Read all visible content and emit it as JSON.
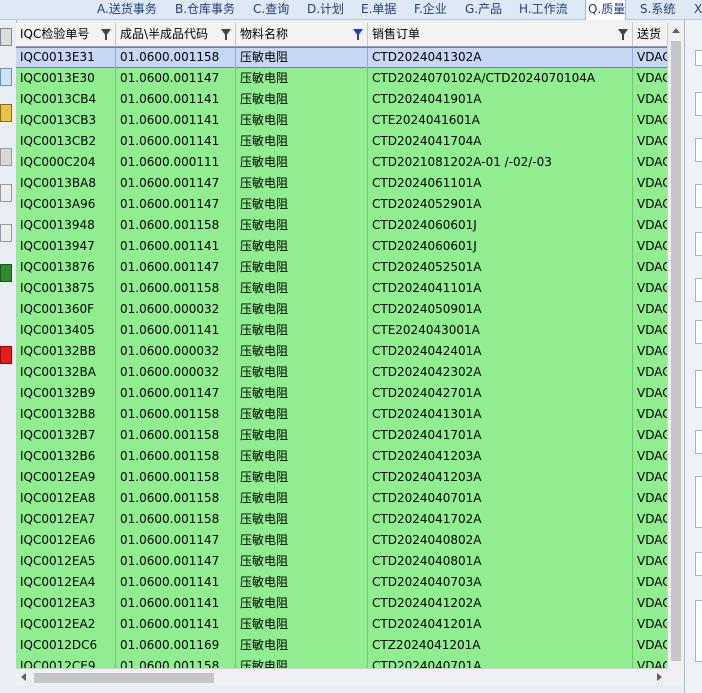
{
  "menu": {
    "items": [
      "A.送货事务",
      "B.仓库事务",
      "C.查询",
      "D.计划",
      "E.单据",
      "F.企业",
      "G.产品",
      "H.工作流",
      "Q.质量",
      "S.系统",
      "X"
    ],
    "active": "Q.质量"
  },
  "grid": {
    "columns": [
      "IQC检验单号",
      "成品\\半成品代码",
      "物料名称",
      "销售订单",
      "送货"
    ],
    "rows": [
      [
        "IQC0013E31",
        "01.0600.001158",
        "压敏电阻",
        "CTD2024041302A",
        "VDAC"
      ],
      [
        "IQC0013E30",
        "01.0600.001147",
        "压敏电阻",
        "CTD2024070102A/CTD2024070104A",
        "VDAC"
      ],
      [
        "IQC0013CB4",
        "01.0600.001141",
        "压敏电阻",
        "CTD2024041901A",
        "VDAC"
      ],
      [
        "IQC0013CB3",
        "01.0600.001141",
        "压敏电阻",
        "CTE2024041601A",
        "VDAC"
      ],
      [
        "IQC0013CB2",
        "01.0600.001141",
        "压敏电阻",
        "CTD2024041704A",
        "VDAC"
      ],
      [
        "IQC000C204",
        "01.0600.000111",
        "压敏电阻",
        "CTD2021081202A-01 /-02/-03",
        "VDAC"
      ],
      [
        "IQC0013BA8",
        "01.0600.001147",
        "压敏电阻",
        "CTD2024061101A",
        "VDAC"
      ],
      [
        "IQC0013A96",
        "01.0600.001147",
        "压敏电阻",
        "CTD2024052901A",
        "VDAC"
      ],
      [
        "IQC0013948",
        "01.0600.001158",
        "压敏电阻",
        "CTD2024060601J",
        "VDAC"
      ],
      [
        "IQC0013947",
        "01.0600.001141",
        "压敏电阻",
        "CTD2024060601J",
        "VDAC"
      ],
      [
        "IQC0013876",
        "01.0600.001147",
        "压敏电阻",
        "CTD2024052501A",
        "VDAC"
      ],
      [
        "IQC0013875",
        "01.0600.001158",
        "压敏电阻",
        "CTD2024041101A",
        "VDAC"
      ],
      [
        "IQC001360F",
        "01.0600.000032",
        "压敏电阻",
        "CTD2024050901A",
        "VDAC"
      ],
      [
        "IQC0013405",
        "01.0600.001141",
        "压敏电阻",
        "CTE2024043001A",
        "VDAC"
      ],
      [
        "IQC00132BB",
        "01.0600.000032",
        "压敏电阻",
        "CTD2024042401A",
        "VDAC"
      ],
      [
        "IQC00132BA",
        "01.0600.000032",
        "压敏电阻",
        "CTD2024042302A",
        "VDAC"
      ],
      [
        "IQC00132B9",
        "01.0600.001147",
        "压敏电阻",
        "CTD2024042701A",
        "VDAC"
      ],
      [
        "IQC00132B8",
        "01.0600.001158",
        "压敏电阻",
        "CTD2024041301A",
        "VDAC"
      ],
      [
        "IQC00132B7",
        "01.0600.001158",
        "压敏电阻",
        "CTD2024041701A",
        "VDAC"
      ],
      [
        "IQC00132B6",
        "01.0600.001158",
        "压敏电阻",
        "CTD2024041203A",
        "VDAC"
      ],
      [
        "IQC0012EA9",
        "01.0600.001158",
        "压敏电阻",
        "CTD2024041203A",
        "VDAC"
      ],
      [
        "IQC0012EA8",
        "01.0600.001158",
        "压敏电阻",
        "CTD2024040701A",
        "VDAC"
      ],
      [
        "IQC0012EA7",
        "01.0600.001158",
        "压敏电阻",
        "CTD2024041702A",
        "VDAC"
      ],
      [
        "IQC0012EA6",
        "01.0600.001147",
        "压敏电阻",
        "CTD2024040802A",
        "VDAC"
      ],
      [
        "IQC0012EA5",
        "01.0600.001147",
        "压敏电阻",
        "CTD2024040801A",
        "VDAC"
      ],
      [
        "IQC0012EA4",
        "01.0600.001141",
        "压敏电阻",
        "CTD2024040703A",
        "VDAC"
      ],
      [
        "IQC0012EA3",
        "01.0600.001141",
        "压敏电阻",
        "CTD2024041202A",
        "VDAC"
      ],
      [
        "IQC0012EA2",
        "01.0600.001141",
        "压敏电阻",
        "CTD2024041201A",
        "VDAC"
      ],
      [
        "IQC0012DC6",
        "01.0600.001169",
        "压敏电阻",
        "CTZ2024041201A",
        "VDAC"
      ],
      [
        "IQC0012CE9",
        "01.0600.001158",
        "压敏电阻",
        "CTD2024040701A",
        "VDAC"
      ]
    ],
    "selected_row": 0
  },
  "colors": {
    "row_bg": "#90ee90",
    "selected_bg": "#c8d7f4",
    "menu_text": "#1f3f7a",
    "filter_active": "#1a3fd0"
  },
  "icons": {
    "column_filter": "funnel-icon",
    "active_filter": "funnel-active-icon"
  }
}
